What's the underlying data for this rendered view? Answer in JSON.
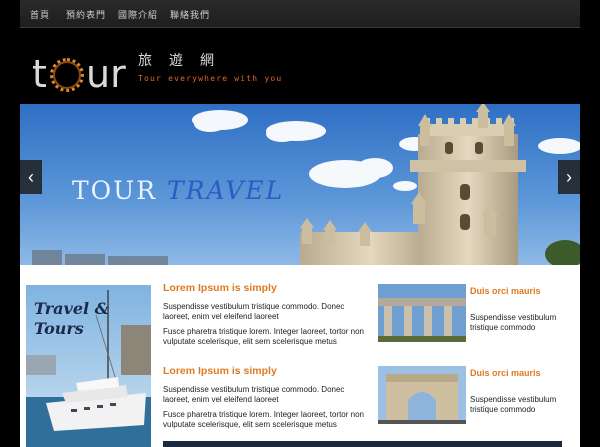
{
  "nav": {
    "items": [
      "首頁",
      "預約表門",
      "國際介紹",
      "聯絡我們"
    ]
  },
  "header": {
    "logo_text": "tOur",
    "chinese_title": "旅遊網",
    "tagline": "Tour everywhere with you"
  },
  "banner": {
    "title_word1": "TOUR",
    "title_word2": "TRAVEL",
    "prev": "‹",
    "next": "›"
  },
  "sidebar_ad": {
    "line1": "Travel &",
    "line2": "Tours"
  },
  "articles": [
    {
      "title": "Lorem Ipsum is simply",
      "para1": "Suspendisse vestibulum tristique commodo. Donec laoreet, enim vel eleifend laoreet",
      "para2": "Fusce pharetra tristique lorem. Integer laoreet, tortor non vulputate scelerisque, elit sem scelerisque metus"
    },
    {
      "title": "Lorem Ipsum is simply",
      "para1": "Suspendisse vestibulum tristique commodo. Donec laoreet, enim vel eleifend laoreet",
      "para2": "Fusce pharetra tristique lorem. Integer laoreet, tortor non vulputate scelerisque, elit sem scelerisque metus"
    }
  ],
  "side_items": [
    {
      "title": "Duis orci mauris",
      "text": "Suspendisse vestibulum tristique commodo"
    },
    {
      "title": "Duis orci mauris",
      "text": "Suspendisse vestibulum tristique commodo"
    }
  ]
}
